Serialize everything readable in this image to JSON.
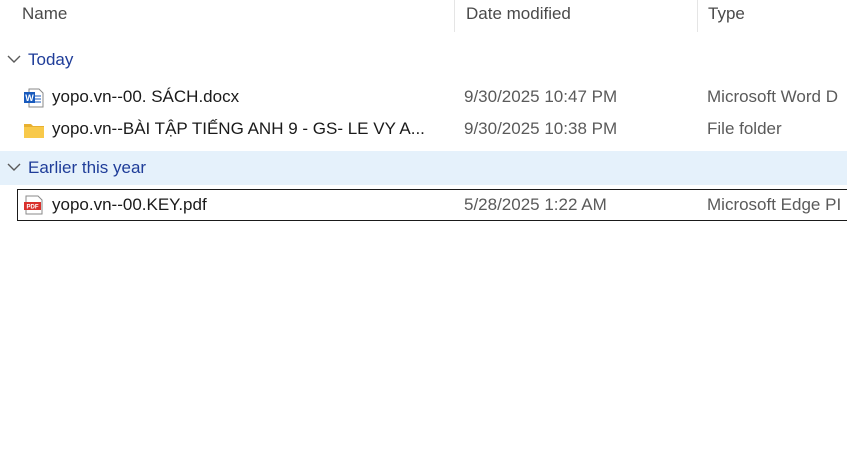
{
  "columns": {
    "name": "Name",
    "date": "Date modified",
    "type": "Type"
  },
  "groups": [
    {
      "label": "Today",
      "files": [
        {
          "name": "yopo.vn--00. SÁCH.docx",
          "date": "9/30/2025 10:47 PM",
          "type": "Microsoft Word D",
          "icon": "word-document-icon"
        },
        {
          "name": "yopo.vn--BÀI TẬP TIẾNG ANH 9 - GS- LE VY  A...",
          "date": "9/30/2025 10:38 PM",
          "type": "File folder",
          "icon": "folder-icon"
        }
      ]
    },
    {
      "label": "Earlier this year",
      "files": [
        {
          "name": "yopo.vn--00.KEY.pdf",
          "date": "5/28/2025 1:22 AM",
          "type": "Microsoft Edge PI",
          "icon": "pdf-document-icon"
        }
      ]
    }
  ],
  "colors": {
    "group_text": "#1f3d99",
    "selected_group_bg": "#e5f1fb",
    "word_blue": "#185abd",
    "folder_yellow": "#f8c94a",
    "pdf_red": "#d9302c"
  }
}
